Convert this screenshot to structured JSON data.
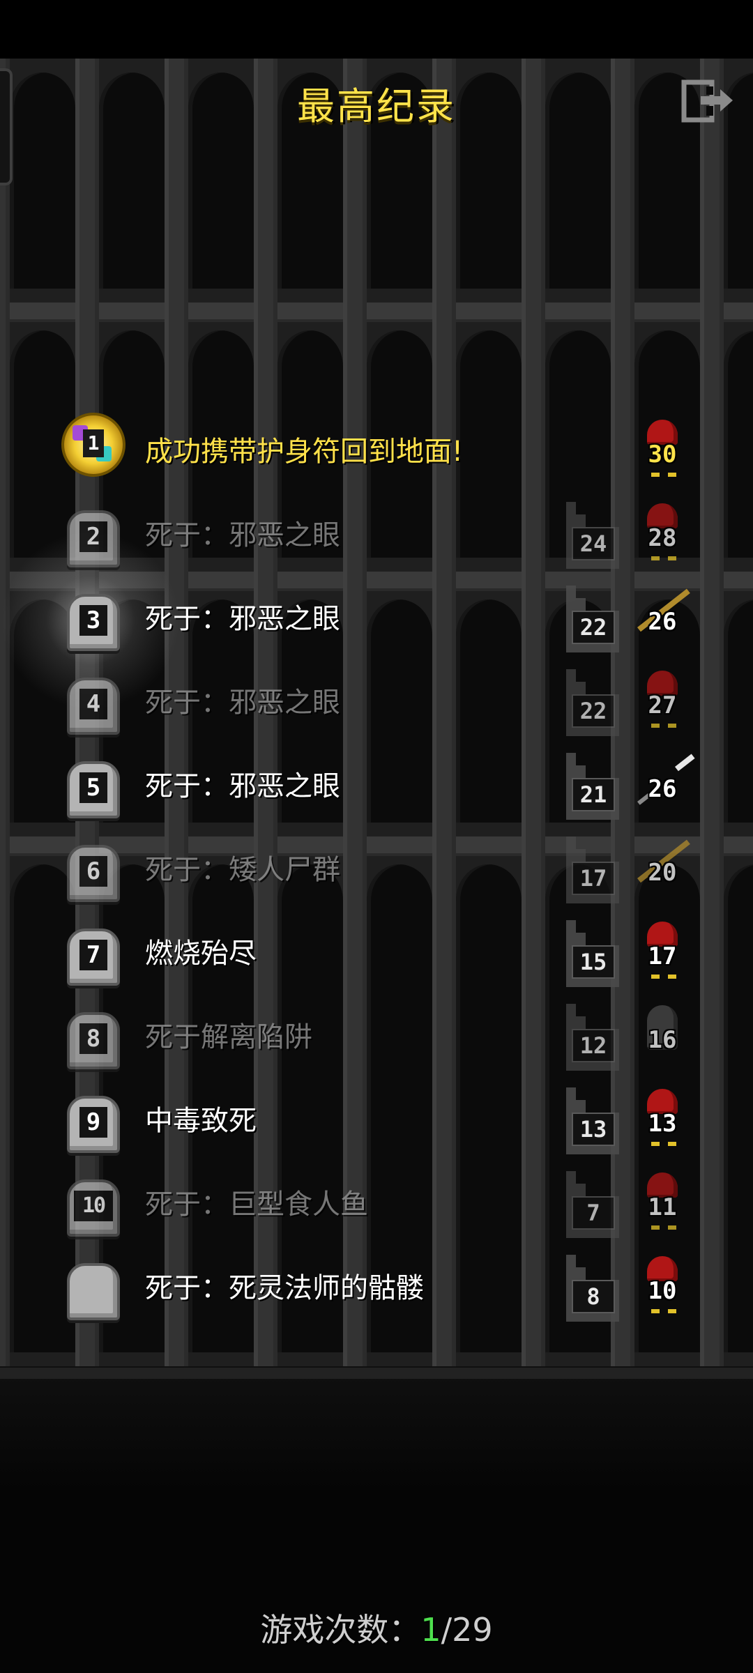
{
  "screen": {
    "title": "最高纪录",
    "exit_icon": "exit-door-icon"
  },
  "records": [
    {
      "rank": "1",
      "rank_icon": "amulet-medal-icon",
      "cause": "成功携带护身符回到地面!",
      "depth": "",
      "level": "30",
      "hero_icon": "warrior-helmet-icon",
      "style": "gold"
    },
    {
      "rank": "2",
      "rank_icon": "tombstone-icon",
      "cause": "死于：邪恶之眼",
      "depth": "24",
      "level": "28",
      "hero_icon": "warrior-helmet-icon",
      "style": "dim"
    },
    {
      "rank": "3",
      "rank_icon": "tombstone-icon",
      "cause": "死于：邪恶之眼",
      "depth": "22",
      "level": "26",
      "hero_icon": "mage-staff-icon",
      "style": "bright"
    },
    {
      "rank": "4",
      "rank_icon": "tombstone-icon",
      "cause": "死于：邪恶之眼",
      "depth": "22",
      "level": "27",
      "hero_icon": "warrior-helmet-icon",
      "style": "dim"
    },
    {
      "rank": "5",
      "rank_icon": "tombstone-icon",
      "cause": "死于：邪恶之眼",
      "depth": "21",
      "level": "26",
      "hero_icon": "huntress-spear-icon",
      "style": "bright"
    },
    {
      "rank": "6",
      "rank_icon": "tombstone-icon",
      "cause": "死于：矮人尸群",
      "depth": "17",
      "level": "20",
      "hero_icon": "mage-staff-icon",
      "style": "dim"
    },
    {
      "rank": "7",
      "rank_icon": "tombstone-icon",
      "cause": "燃烧殆尽",
      "depth": "15",
      "level": "17",
      "hero_icon": "warrior-helmet-icon",
      "style": "bright"
    },
    {
      "rank": "8",
      "rank_icon": "tombstone-icon",
      "cause": "死于解离陷阱",
      "depth": "12",
      "level": "16",
      "hero_icon": "rogue-hood-icon",
      "style": "dim"
    },
    {
      "rank": "9",
      "rank_icon": "tombstone-icon",
      "cause": "中毒致死",
      "depth": "13",
      "level": "13",
      "hero_icon": "warrior-helmet-icon",
      "style": "bright"
    },
    {
      "rank": "10",
      "rank_icon": "tombstone-icon",
      "cause": "死于：巨型食人鱼",
      "depth": "7",
      "level": "11",
      "hero_icon": "warrior-helmet-icon",
      "style": "dim"
    },
    {
      "rank": "",
      "rank_icon": "blank-tombstone-icon",
      "cause": "死于：死灵法师的骷髅",
      "depth": "8",
      "level": "10",
      "hero_icon": "warrior-helmet-icon",
      "style": "bright"
    }
  ],
  "footer": {
    "games_label": "游戏次数：",
    "games_current": "1",
    "games_total": "/29"
  },
  "colors": {
    "title": "#ffe34a",
    "highlight_record": "#ffe14a",
    "current_count": "#4ee04e"
  }
}
